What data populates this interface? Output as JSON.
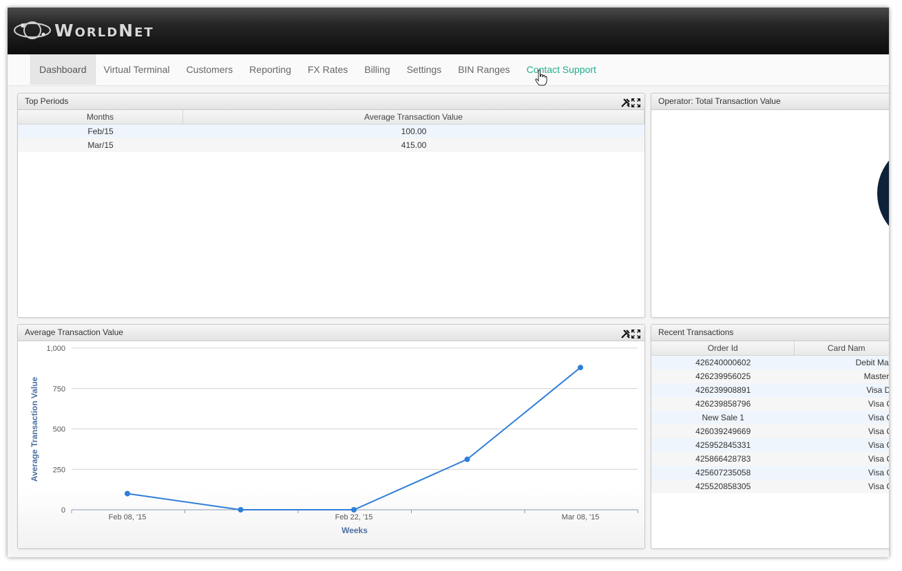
{
  "app": {
    "logo_text": "WorldNet"
  },
  "nav": {
    "items": [
      "Dashboard",
      "Virtual Terminal",
      "Customers",
      "Reporting",
      "FX Rates",
      "Billing",
      "Settings",
      "BIN Ranges",
      "Contact Support"
    ]
  },
  "top_periods": {
    "title": "Top Periods",
    "columns": [
      "Months",
      "Average Transaction Value"
    ],
    "rows": [
      [
        "Feb/15",
        "100.00"
      ],
      [
        "Mar/15",
        "415.00"
      ]
    ]
  },
  "operator_panel": {
    "title": "Operator: Total Transaction Value"
  },
  "avg_chart": {
    "title": "Average Transaction Value",
    "ylabel": "Average Transaction Value",
    "xlabel": "Weeks",
    "y_ticks": [
      "0",
      "250",
      "500",
      "750",
      "1,000"
    ],
    "x_ticks": [
      "Feb 08, '15",
      "Feb 22, '15",
      "Mar 08, '15"
    ]
  },
  "recent": {
    "title": "Recent Transactions",
    "columns": [
      "Order Id",
      "Card Nam"
    ],
    "rows": [
      [
        "426240000602",
        "Debit Mast"
      ],
      [
        "426239956025",
        "MasterC"
      ],
      [
        "426239908891",
        "Visa De"
      ],
      [
        "426239858796",
        "Visa Cr"
      ],
      [
        "New Sale 1",
        "Visa Cr"
      ],
      [
        "426039249669",
        "Visa Cr"
      ],
      [
        "425952845331",
        "Visa Cr"
      ],
      [
        "425866428783",
        "Visa Cr"
      ],
      [
        "425607235058",
        "Visa Cr"
      ],
      [
        "425520858305",
        "Visa Cr"
      ]
    ]
  },
  "colors": {
    "accent": "#1fae8e",
    "line": "#2f7ed8",
    "axis_title": "#4d6fa1"
  },
  "chart_data": {
    "type": "line",
    "x": [
      "2015-02-08",
      "2015-02-15",
      "2015-02-22",
      "2015-03-01",
      "2015-03-08"
    ],
    "y": [
      100,
      0,
      0,
      312,
      880
    ],
    "xlabel": "Weeks",
    "ylabel": "Average Transaction Value",
    "ylim": [
      0,
      1000
    ],
    "grid": true
  }
}
